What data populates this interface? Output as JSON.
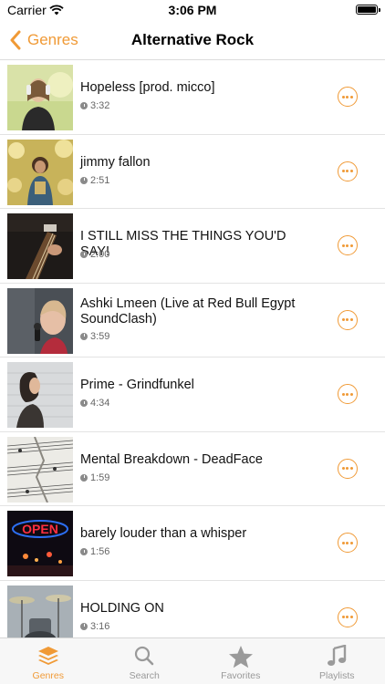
{
  "status_bar": {
    "carrier": "Carrier",
    "time": "3:06 PM"
  },
  "nav": {
    "back_label": "Genres",
    "title": "Alternative Rock"
  },
  "tracks": [
    {
      "title": "Hopeless [prod. micco]",
      "duration": "3:32",
      "thumb": "woman-headphones"
    },
    {
      "title": "jimmy fallon",
      "duration": "2:51",
      "thumb": "woman-in-flowers"
    },
    {
      "title": "I STILL MISS THE THINGS YOU'D SAY!",
      "duration": "2:00",
      "thumb": "guitar-closeup"
    },
    {
      "title": "Ashki Lmeen (Live at Red Bull Egypt SoundClash)",
      "duration": "3:59",
      "thumb": "girl-singing-microphone"
    },
    {
      "title": "Prime - Grindfunkel",
      "duration": "4:34",
      "thumb": "woman-profile-brick-wall"
    },
    {
      "title": "Mental Breakdown - DeadFace",
      "duration": "1:59",
      "thumb": "sheet-music"
    },
    {
      "title": "barely louder than a whisper",
      "duration": "1:56",
      "thumb": "open-neon-sign"
    },
    {
      "title": "HOLDING ON",
      "duration": "3:16",
      "thumb": "drum-kit"
    }
  ],
  "tabs": [
    {
      "label": "Genres",
      "icon": "layers-icon",
      "active": true
    },
    {
      "label": "Search",
      "icon": "search-icon",
      "active": false
    },
    {
      "label": "Favorites",
      "icon": "star-icon",
      "active": false
    },
    {
      "label": "Playlists",
      "icon": "music-note-icon",
      "active": false
    }
  ],
  "colors": {
    "accent": "#f09a36",
    "inactive_tab": "#999999",
    "separator": "#e3e3e3"
  }
}
